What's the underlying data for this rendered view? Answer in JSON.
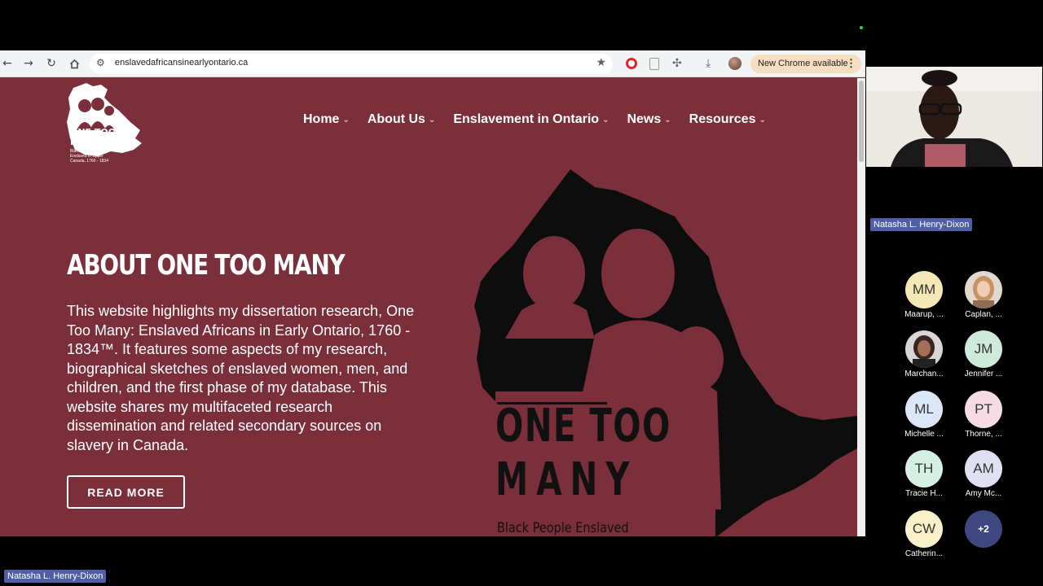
{
  "browser": {
    "url": "enslavedafricansinearlyontario.ca",
    "update_label": "New Chrome available"
  },
  "site": {
    "logo": {
      "line1": "ONE TOO",
      "line2": "MANY",
      "tagline": "Black People Enslaved in Upper Canada, 1760 - 1834"
    },
    "nav": [
      {
        "label": "Home"
      },
      {
        "label": "About Us"
      },
      {
        "label": "Enslavement in Ontario"
      },
      {
        "label": "News"
      },
      {
        "label": "Resources"
      }
    ],
    "hero": {
      "title": "ABOUT ONE TOO MANY",
      "body": "This website highlights my dissertation research, One Too Many: Enslaved Africans in Early Ontario, 1760 - 1834™. It features some aspects of my research, biographical sketches of enslaved women, men, and children, and the first phase of my database. This website shares my multifaceted research dissemination and related secondary sources on slavery in Canada.",
      "button": "READ MORE"
    },
    "art": {
      "title_line1": "ONE TOO",
      "title_line2": "MANY",
      "subtitle": "Black People Enslaved"
    }
  },
  "meeting": {
    "speaker_name": "Natasha L. Henry-Dixon",
    "participants": [
      {
        "initials": "MM",
        "name": "Maarup, ...",
        "color": "#f6e7b6",
        "photo": false
      },
      {
        "initials": "",
        "name": "Caplan, ...",
        "color": "#c9a27e",
        "photo": true
      },
      {
        "initials": "",
        "name": "Marchan...",
        "color": "#7d5a4c",
        "photo": true
      },
      {
        "initials": "JM",
        "name": "Jennifer ...",
        "color": "#cdeadb",
        "photo": false
      },
      {
        "initials": "ML",
        "name": "Michelle ...",
        "color": "#dbe6f6",
        "photo": false
      },
      {
        "initials": "PT",
        "name": "Thorne, ...",
        "color": "#f6dbe3",
        "photo": false
      },
      {
        "initials": "TH",
        "name": "Tracie H...",
        "color": "#d5f0e2",
        "photo": false
      },
      {
        "initials": "AM",
        "name": "Amy Mc...",
        "color": "#dfe1f2",
        "photo": false
      },
      {
        "initials": "CW",
        "name": "Catherin...",
        "color": "#f8f0c8",
        "photo": false
      }
    ],
    "more_count": "+2"
  }
}
